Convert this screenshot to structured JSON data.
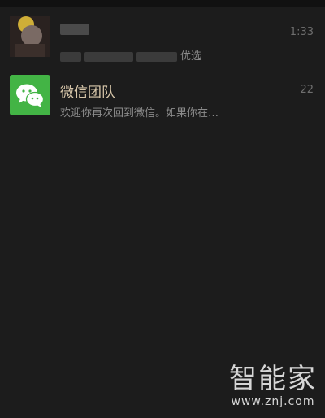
{
  "chats": [
    {
      "name": "",
      "preview_suffix": "优选",
      "time": "1:33"
    },
    {
      "name": "微信团队",
      "preview": "欢迎你再次回到微信。如果你在…",
      "time": "22"
    }
  ],
  "watermark": {
    "title": "智能家",
    "url": "www.znj.com"
  },
  "colors": {
    "background": "#1c1c1c",
    "name_color": "#d8c7aa",
    "wechat_green": "#43b445"
  }
}
